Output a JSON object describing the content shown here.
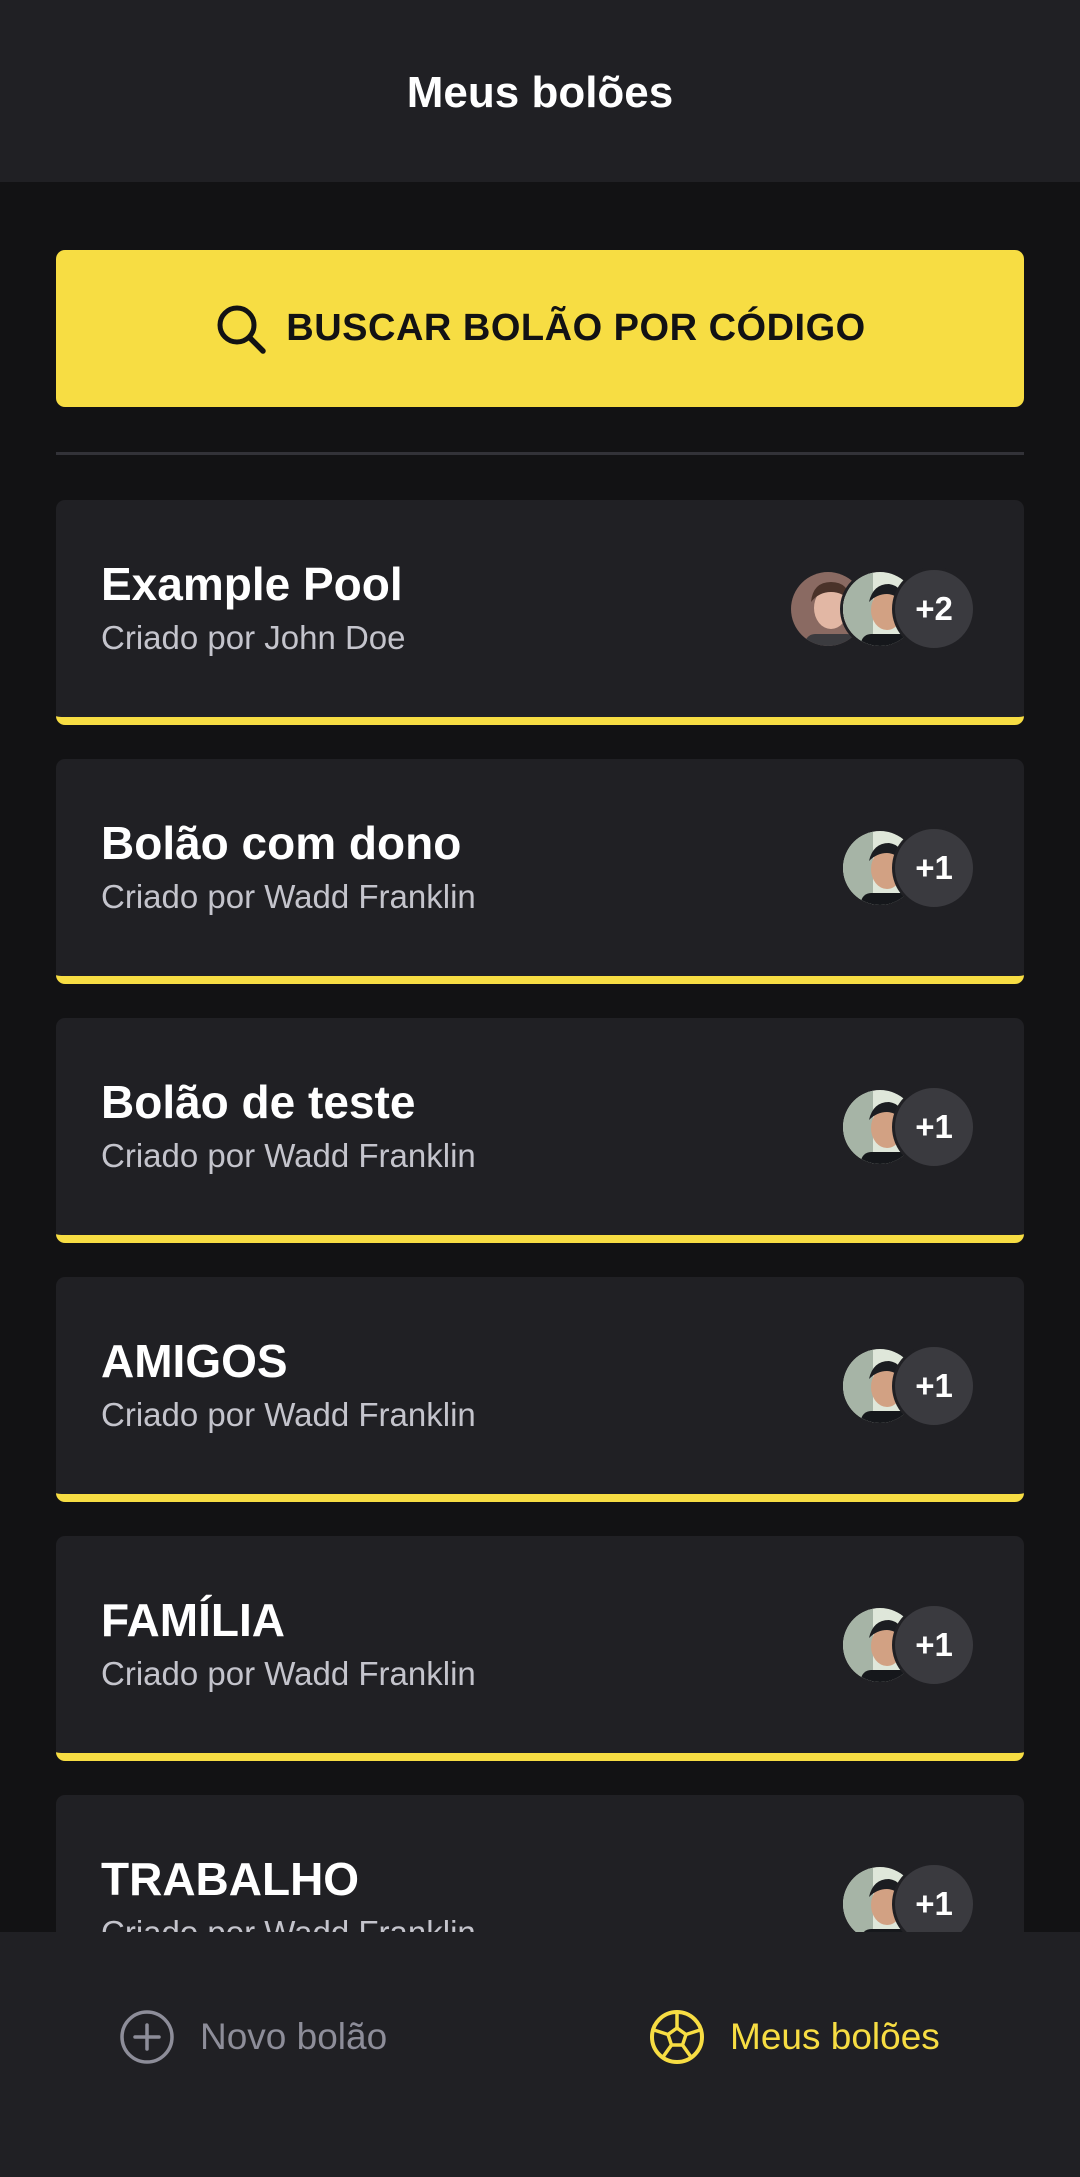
{
  "header": {
    "title": "Meus bolões"
  },
  "search": {
    "label": "BUSCAR BOLÃO POR CÓDIGO"
  },
  "pools": [
    {
      "title": "Example Pool",
      "owner": "Criado por John Doe",
      "extra": "+2",
      "avatars": [
        "a",
        "b"
      ]
    },
    {
      "title": "Bolão com dono",
      "owner": "Criado por Wadd Franklin",
      "extra": "+1",
      "avatars": [
        "b"
      ]
    },
    {
      "title": "Bolão de teste",
      "owner": "Criado por Wadd Franklin",
      "extra": "+1",
      "avatars": [
        "b"
      ]
    },
    {
      "title": "AMIGOS",
      "owner": "Criado por Wadd Franklin",
      "extra": "+1",
      "avatars": [
        "b"
      ]
    },
    {
      "title": "FAMÍLIA",
      "owner": "Criado por Wadd Franklin",
      "extra": "+1",
      "avatars": [
        "b"
      ]
    },
    {
      "title": "TRABALHO",
      "owner": "Criado por Wadd Franklin",
      "extra": "+1",
      "avatars": [
        "b"
      ]
    }
  ],
  "nav": {
    "new_label": "Novo bolão",
    "new_icon": "plus-circle-icon",
    "mine_label": "Meus bolões",
    "mine_icon": "soccer-ball-icon"
  },
  "colors": {
    "accent": "#f7dd43",
    "background": "#121214",
    "surface": "#202024",
    "muted": "#8d8d99"
  }
}
